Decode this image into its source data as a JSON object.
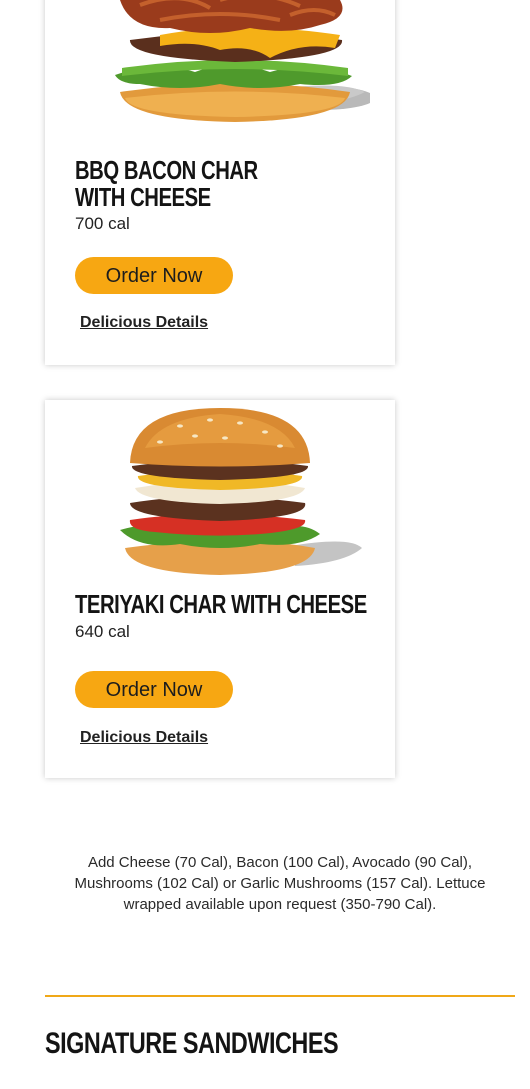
{
  "menu_items": [
    {
      "name": "BBQ BACON CHAR WITH CHEESE",
      "calories": "700 cal",
      "order_label": "Order Now",
      "details_label": "Delicious Details"
    },
    {
      "name": "TERIYAKI CHAR WITH CHEESE",
      "calories": "640 cal",
      "order_label": "Order Now",
      "details_label": "Delicious Details"
    }
  ],
  "footnote": "Add Cheese (70 Cal), Bacon (100 Cal), Avocado (90 Cal), Mushrooms (102 Cal) or Garlic Mushrooms (157 Cal). Lettuce wrapped available upon request (350-790 Cal).",
  "section_title": "SIGNATURE SANDWICHES",
  "colors": {
    "accent": "#f7a712",
    "divider": "#f0a818",
    "text": "#1d1d1d"
  }
}
